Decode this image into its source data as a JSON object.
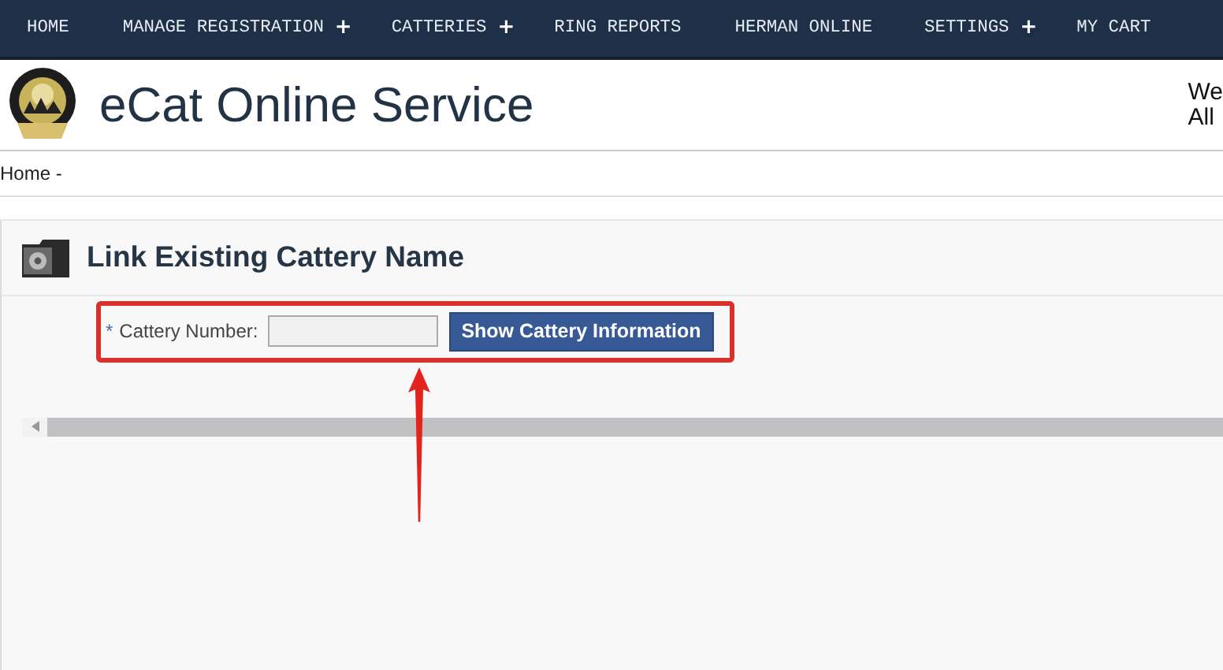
{
  "nav": [
    {
      "label": "HOME",
      "has_submenu": false
    },
    {
      "label": "MANAGE REGISTRATION",
      "has_submenu": true
    },
    {
      "label": "CATTERIES",
      "has_submenu": true
    },
    {
      "label": "RING REPORTS",
      "has_submenu": false
    },
    {
      "label": "HERMAN ONLINE",
      "has_submenu": false
    },
    {
      "label": "SETTINGS",
      "has_submenu": true
    },
    {
      "label": "MY CART",
      "has_submenu": false
    }
  ],
  "submenu_glyph": "+",
  "header": {
    "title": "eCat Online Service",
    "side_lines": [
      "We",
      "All"
    ]
  },
  "breadcrumb": "Home -",
  "panel": {
    "title": "Link Existing Cattery Name",
    "form": {
      "required_mark": "*",
      "label": "Cattery Number:",
      "button": "Show Cattery Information",
      "highlighted": true
    }
  }
}
